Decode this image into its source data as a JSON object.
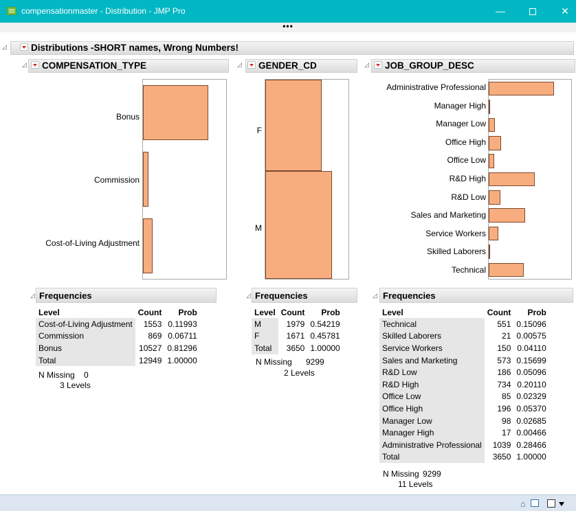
{
  "window": {
    "title": "compensationmaster - Distribution - JMP Pro",
    "minimize": "—",
    "close": "✕",
    "overflow_dots": "•••"
  },
  "report": {
    "title": "Distributions -SHORT names, Wrong Numbers!"
  },
  "panels": [
    {
      "title": "COMPENSATION_TYPE",
      "bar_labels": [
        "Bonus",
        "Commission",
        "Cost-of-Living Adjustment"
      ],
      "bar_probs": [
        0.81296,
        0.06711,
        0.11993
      ],
      "freq_title": "Frequencies",
      "columns": [
        "Level",
        "Count",
        "Prob"
      ],
      "rows": [
        [
          "Cost-of-Living Adjustment",
          "1553",
          "0.11993"
        ],
        [
          "Commission",
          "869",
          "0.06711"
        ],
        [
          "Bonus",
          "10527",
          "0.81296"
        ],
        [
          "Total",
          "12949",
          "1.00000"
        ]
      ],
      "n_missing_label": "N Missing",
      "n_missing_value": "0",
      "levels": "3 Levels"
    },
    {
      "title": "GENDER_CD",
      "bar_labels": [
        "F",
        "M"
      ],
      "bar_probs": [
        0.45781,
        0.54219
      ],
      "freq_title": "Frequencies",
      "columns": [
        "Level",
        "Count",
        "Prob"
      ],
      "rows": [
        [
          "M",
          "1979",
          "0.54219"
        ],
        [
          "F",
          "1671",
          "0.45781"
        ],
        [
          "Total",
          "3650",
          "1.00000"
        ]
      ],
      "n_missing_label": "N Missing",
      "n_missing_value": "9299",
      "levels": "2 Levels"
    },
    {
      "title": "JOB_GROUP_DESC",
      "bar_labels": [
        "Administrative Professional",
        "Manager High",
        "Manager Low",
        "Office High",
        "Office Low",
        "R&D High",
        "R&D Low",
        "Sales and Marketing",
        "Service Workers",
        "Skilled Laborers",
        "Technical"
      ],
      "bar_probs": [
        0.28466,
        0.00466,
        0.02685,
        0.0537,
        0.02329,
        0.2011,
        0.05096,
        0.15699,
        0.0411,
        0.00575,
        0.15096
      ],
      "freq_title": "Frequencies",
      "columns": [
        "Level",
        "Count",
        "Prob"
      ],
      "rows": [
        [
          "Technical",
          "551",
          "0.15096"
        ],
        [
          "Skilled Laborers",
          "21",
          "0.00575"
        ],
        [
          "Service Workers",
          "150",
          "0.04110"
        ],
        [
          "Sales and Marketing",
          "573",
          "0.15699"
        ],
        [
          "R&D Low",
          "186",
          "0.05096"
        ],
        [
          "R&D High",
          "734",
          "0.20110"
        ],
        [
          "Office Low",
          "85",
          "0.02329"
        ],
        [
          "Office High",
          "196",
          "0.05370"
        ],
        [
          "Manager Low",
          "98",
          "0.02685"
        ],
        [
          "Manager High",
          "17",
          "0.00466"
        ],
        [
          "Administrative Professional",
          "1039",
          "0.28466"
        ],
        [
          "Total",
          "3650",
          "1.00000"
        ]
      ],
      "n_missing_label": "N Missing",
      "n_missing_value": "9299",
      "levels": "11 Levels"
    }
  ],
  "colors": {
    "titlebar": "#00b7c3",
    "bar_fill": "#f8ad7f",
    "bar_stroke": "#7a4a2c"
  }
}
